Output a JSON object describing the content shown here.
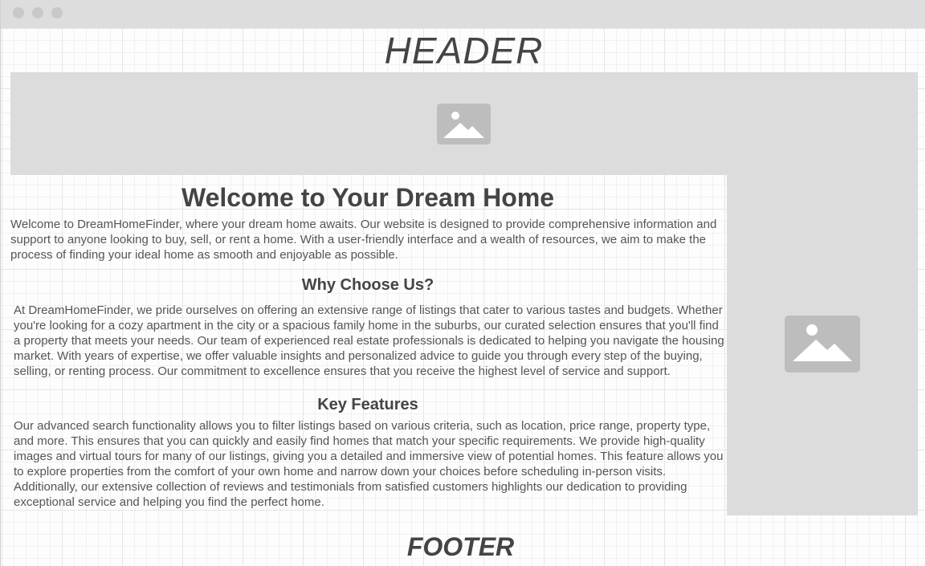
{
  "header": {
    "text": "HEADER"
  },
  "banner": {
    "icon": "image-placeholder-icon",
    "color": "#dcdcdc"
  },
  "sidebar": {
    "icon": "image-placeholder-icon",
    "color": "#dcdcdc"
  },
  "main": {
    "title": "Welcome to Your Dream Home",
    "intro": "Welcome to DreamHomeFinder, where your dream home awaits. Our website is designed to provide comprehensive information and support to anyone looking to buy, sell, or rent a home. With a user-friendly interface and a wealth of resources, we aim to make the process of finding your ideal home as smooth and enjoyable as possible.",
    "sections": [
      {
        "title": "Why Choose Us?",
        "text": "At DreamHomeFinder, we pride ourselves on offering an extensive range of listings that cater to various tastes and budgets. Whether you're looking for a cozy apartment in the city or a spacious family home in the suburbs, our curated selection ensures that you'll find a property that meets your needs. Our team of experienced real estate professionals is dedicated to helping you navigate the housing market. With years of expertise, we offer valuable insights and personalized advice to guide you through every step of the buying, selling, or renting process. Our commitment to excellence ensures that you receive the highest level of service and support."
      },
      {
        "title": "Key Features",
        "text": "Our advanced search functionality allows you to filter listings based on various criteria, such as location, price range, property type, and more. This ensures that you can quickly and easily find homes that match your specific requirements. We provide high-quality images and virtual tours for many of our listings, giving you a detailed and immersive view of potential homes. This feature allows you to explore properties from the comfort of your own home and narrow down your choices before scheduling in-person visits. Additionally, our extensive collection of reviews and testimonials from satisfied customers highlights our dedication to providing exceptional service and helping you find the perfect home."
      }
    ]
  },
  "footer": {
    "text": "FOOTER"
  }
}
